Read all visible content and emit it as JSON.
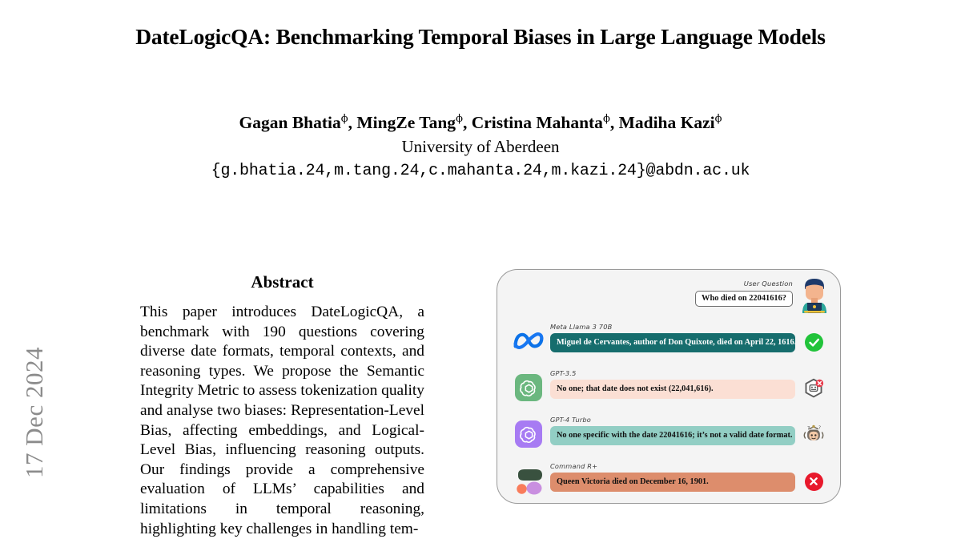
{
  "arxiv_stamp": "17 Dec 2024",
  "paper": {
    "title": "DateLogicQA: Benchmarking Temporal Biases in Large Language Models",
    "authors": [
      {
        "name": "Gagan Bhatia",
        "mark": "ϕ"
      },
      {
        "name": "MingZe Tang",
        "mark": "ϕ"
      },
      {
        "name": "Cristina Mahanta",
        "mark": "ϕ"
      },
      {
        "name": "Madiha Kazi",
        "mark": "ϕ"
      }
    ],
    "authors_line": "Gagan Bhatia ϕ, MingZe Tang ϕ, Cristina Mahanta ϕ, Madiha Kazi ϕ",
    "affiliation": "University of Aberdeen",
    "emails": "{g.bhatia.24,m.tang.24,c.mahanta.24,m.kazi.24}@abdn.ac.uk",
    "abstract_heading": "Abstract",
    "abstract_body": "This paper introduces DateLogicQA, a benchmark with 190 questions covering diverse date formats, temporal contexts, and reasoning types. We propose the Semantic Integrity Metric to assess tokenization quality and analyse two biases: Representation-Level Bias, affecting embeddings, and Logical-Level Bias, influencing reasoning outputs. Our findings provide a comprehensive evaluation of LLMs’ capabilities and limitations in temporal reasoning, highlighting key challenges in handling tem-"
  },
  "figure": {
    "user": {
      "label": "User Question",
      "question": "Who died on 22041616?",
      "avatar_icon": "user-at-laptop-avatar"
    },
    "rows": [
      {
        "model": "Meta Llama 3 70B",
        "logo_icon": "meta-infinity-logo",
        "answer": "Miguel de Cervantes, author of Don Quixote, died on April 22, 1616.",
        "bubble_bg": "#166d6d",
        "bubble_text": "#ffffff",
        "verdict_icon": "green-check-circle-icon",
        "verdict": "correct"
      },
      {
        "model": "GPT-3.5",
        "logo_icon": "openai-logo-green-tile",
        "answer": "No one; that date does not exist (22,041,616).",
        "bubble_bg": "#fbdfd4",
        "bubble_text": "#111111",
        "verdict_icon": "robot-error-icon",
        "verdict": "error"
      },
      {
        "model": "GPT-4 Turbo",
        "logo_icon": "openai-logo-purple-tile",
        "answer": "No one specific with the date 22041616; it’s not a valid date format.",
        "bubble_bg": "#92cec4",
        "bubble_text": "#111111",
        "verdict_icon": "robot-confused-icon",
        "verdict": "confused"
      },
      {
        "model": "Command R+",
        "logo_icon": "cohere-logo",
        "answer": "Queen Victoria died on December 16, 1901.",
        "bubble_bg": "#dd8d6c",
        "bubble_text": "#111111",
        "verdict_icon": "red-cross-circle-icon",
        "verdict": "incorrect"
      }
    ]
  },
  "colors": {
    "panel_bg": "#f4f4f4",
    "panel_border": "#9a9a9a",
    "meta_blue": "#0c72e8",
    "openai_green": "#6bb77f",
    "openai_purple": "#a77bf3",
    "cohere_dark": "#39513f",
    "cohere_orange": "#f97c5b",
    "cohere_purple": "#c98fe0",
    "verdict_ok": "#21c33a",
    "verdict_bad": "#e8192c",
    "stamp_gray": "#8c8c8c"
  }
}
